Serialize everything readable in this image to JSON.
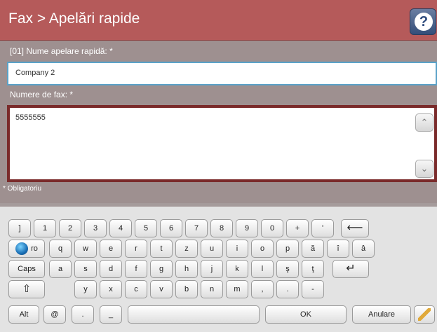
{
  "title": "Fax > Apelări rapide",
  "help_icon": "?",
  "form": {
    "name_label": "[01] Nume apelare rapidă: *",
    "name_value": "Company 2",
    "fax_label": "Numere de fax: *",
    "fax_value": "5555555",
    "required_note": "* Obligatoriu"
  },
  "scroll": {
    "up": "⌃",
    "down": "⌄"
  },
  "keyboard": {
    "row1": [
      "]",
      "1",
      "2",
      "3",
      "4",
      "5",
      "6",
      "7",
      "8",
      "9",
      "0",
      "+",
      "'"
    ],
    "backspace": "⟵",
    "lang": "ro",
    "row2": [
      "q",
      "w",
      "e",
      "r",
      "t",
      "z",
      "u",
      "i",
      "o",
      "p",
      "ă",
      "î",
      "â"
    ],
    "caps": "Caps",
    "row3": [
      "a",
      "s",
      "d",
      "f",
      "g",
      "h",
      "j",
      "k",
      "l",
      "ş",
      "ţ"
    ],
    "enter": "↵",
    "shift": "⇧",
    "row4": [
      "y",
      "x",
      "c",
      "v",
      "b",
      "n",
      "m",
      ",",
      ".",
      "-"
    ],
    "alt": "Alt",
    "at": "@",
    "dot": ".",
    "underscore": "_",
    "ok": "OK",
    "cancel": "Anulare"
  }
}
